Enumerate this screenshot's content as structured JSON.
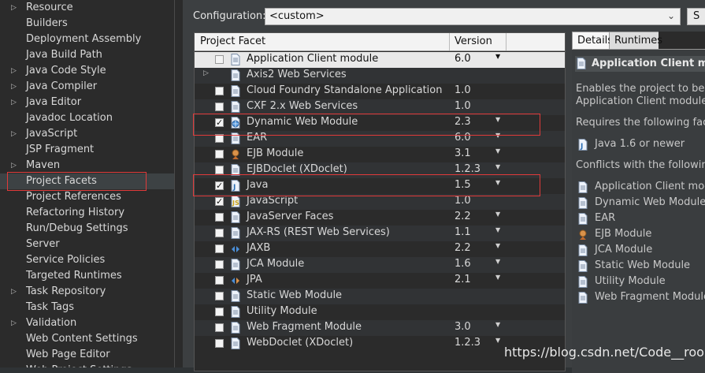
{
  "nav": {
    "items": [
      {
        "label": "Resource",
        "expandable": true
      },
      {
        "label": "Builders",
        "expandable": false
      },
      {
        "label": "Deployment Assembly",
        "expandable": false
      },
      {
        "label": "Java Build Path",
        "expandable": false
      },
      {
        "label": "Java Code Style",
        "expandable": true
      },
      {
        "label": "Java Compiler",
        "expandable": true
      },
      {
        "label": "Java Editor",
        "expandable": true
      },
      {
        "label": "Javadoc Location",
        "expandable": false
      },
      {
        "label": "JavaScript",
        "expandable": true
      },
      {
        "label": "JSP Fragment",
        "expandable": false
      },
      {
        "label": "Maven",
        "expandable": true
      },
      {
        "label": "Project Facets",
        "expandable": false,
        "selected": true
      },
      {
        "label": "Project References",
        "expandable": false
      },
      {
        "label": "Refactoring History",
        "expandable": false
      },
      {
        "label": "Run/Debug Settings",
        "expandable": false
      },
      {
        "label": "Server",
        "expandable": false
      },
      {
        "label": "Service Policies",
        "expandable": false
      },
      {
        "label": "Targeted Runtimes",
        "expandable": false
      },
      {
        "label": "Task Repository",
        "expandable": true
      },
      {
        "label": "Task Tags",
        "expandable": false
      },
      {
        "label": "Validation",
        "expandable": true
      },
      {
        "label": "Web Content Settings",
        "expandable": false
      },
      {
        "label": "Web Page Editor",
        "expandable": false
      },
      {
        "label": "Web Project Settings",
        "expandable": false
      }
    ]
  },
  "config": {
    "label": "Configuration:",
    "value": "<custom>",
    "save_label": "S"
  },
  "table": {
    "header_facet": "Project Facet",
    "header_version": "Version",
    "rows": [
      {
        "name": "Application Client module",
        "version": "6.0",
        "checked": false,
        "icon": "doc-icon",
        "dropdown": true,
        "selected": true
      },
      {
        "name": "Axis2 Web Services",
        "version": "",
        "checked": false,
        "icon": "doc-icon",
        "expander": true
      },
      {
        "name": "Cloud Foundry Standalone Application",
        "version": "1.0",
        "checked": false,
        "icon": "doc-icon"
      },
      {
        "name": "CXF 2.x Web Services",
        "version": "1.0",
        "checked": false,
        "icon": "doc-icon"
      },
      {
        "name": "Dynamic Web Module",
        "version": "2.3",
        "checked": true,
        "icon": "web-module-icon",
        "dropdown": true
      },
      {
        "name": "EAR",
        "version": "6.0",
        "checked": false,
        "icon": "doc-icon",
        "dropdown": true
      },
      {
        "name": "EJB Module",
        "version": "3.1",
        "checked": false,
        "icon": "ejb-bean-icon",
        "dropdown": true
      },
      {
        "name": "EJBDoclet (XDoclet)",
        "version": "1.2.3",
        "checked": false,
        "icon": "doc-icon",
        "dropdown": true
      },
      {
        "name": "Java",
        "version": "1.5",
        "checked": true,
        "icon": "java-icon",
        "dropdown": true
      },
      {
        "name": "JavaScript",
        "version": "1.0",
        "checked": true,
        "icon": "javascript-icon"
      },
      {
        "name": "JavaServer Faces",
        "version": "2.2",
        "checked": false,
        "icon": "doc-icon",
        "dropdown": true
      },
      {
        "name": "JAX-RS (REST Web Services)",
        "version": "1.1",
        "checked": false,
        "icon": "doc-icon",
        "dropdown": true
      },
      {
        "name": "JAXB",
        "version": "2.2",
        "checked": false,
        "icon": "jaxb-icon",
        "dropdown": true
      },
      {
        "name": "JCA Module",
        "version": "1.6",
        "checked": false,
        "icon": "doc-icon",
        "dropdown": true
      },
      {
        "name": "JPA",
        "version": "2.1",
        "checked": false,
        "icon": "jpa-icon",
        "dropdown": true
      },
      {
        "name": "Static Web Module",
        "version": "",
        "checked": false,
        "icon": "doc-icon"
      },
      {
        "name": "Utility Module",
        "version": "",
        "checked": false,
        "icon": "doc-icon"
      },
      {
        "name": "Web Fragment Module",
        "version": "3.0",
        "checked": false,
        "icon": "doc-icon",
        "dropdown": true
      },
      {
        "name": "WebDoclet (XDoclet)",
        "version": "1.2.3",
        "checked": false,
        "icon": "doc-icon",
        "dropdown": true
      }
    ]
  },
  "details": {
    "tab_details": "Details",
    "tab_runtimes": "Runtimes",
    "title": "Application Client modu",
    "description_1": "Enables the project to be de",
    "description_2": "Application Client module.",
    "requires_label": "Requires the following facet",
    "requires": [
      {
        "label": "Java 1.6 or newer",
        "icon": "java-icon"
      }
    ],
    "conflicts_label": "Conflicts with the following f",
    "conflicts": [
      {
        "label": "Application Client modu",
        "icon": "doc-icon"
      },
      {
        "label": "Dynamic Web Module",
        "icon": "doc-icon"
      },
      {
        "label": "EAR",
        "icon": "doc-icon"
      },
      {
        "label": "EJB Module",
        "icon": "ejb-bean-icon"
      },
      {
        "label": "JCA Module",
        "icon": "doc-icon"
      },
      {
        "label": "Static Web Module",
        "icon": "doc-icon"
      },
      {
        "label": "Utility Module",
        "icon": "doc-icon"
      },
      {
        "label": "Web Fragment Module",
        "icon": "doc-icon"
      }
    ]
  },
  "watermark": "https://blog.csdn.net/Code__rookie"
}
